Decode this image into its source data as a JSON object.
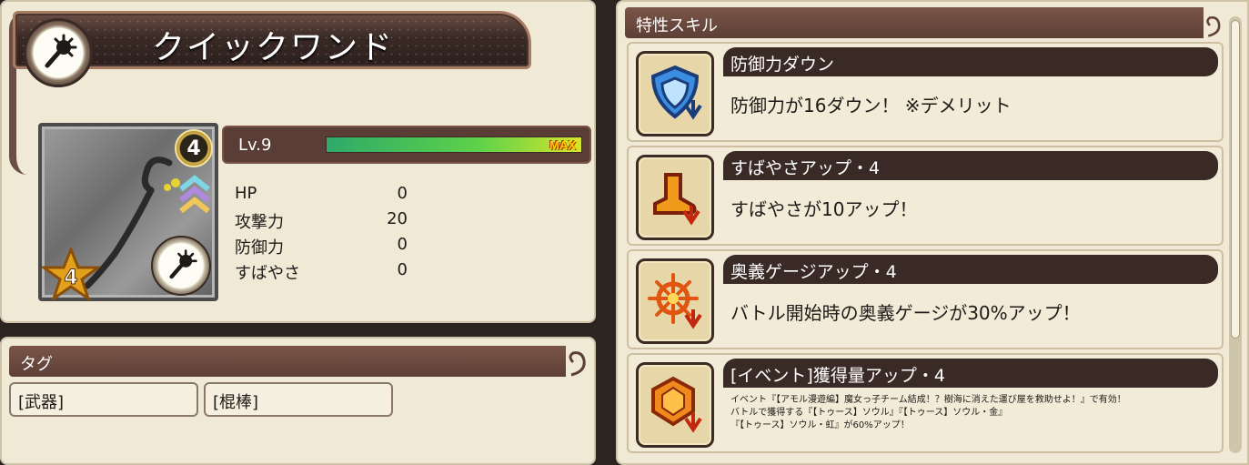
{
  "weapon": {
    "name": "クイックワンド",
    "rank": "4",
    "stars": "4",
    "icon": "mace-icon"
  },
  "level": {
    "label": "Lv.9",
    "max_label": "MAX",
    "progress": 1.0
  },
  "stats": [
    {
      "label": "HP",
      "value": "0"
    },
    {
      "label": "攻撃力",
      "value": "20"
    },
    {
      "label": "防御力",
      "value": "0"
    },
    {
      "label": "すばやさ",
      "value": "0"
    }
  ],
  "tags": {
    "header": "タグ",
    "items": [
      "[武器]",
      "[棍棒]"
    ]
  },
  "skills": {
    "header": "特性スキル",
    "items": [
      {
        "title": "防御力ダウン",
        "desc": "防御力が16ダウン！ ※デメリット",
        "icon": "shield-down-icon"
      },
      {
        "title": "すばやさアップ・4",
        "desc": "すばやさが10アップ！",
        "icon": "boot-up-icon"
      },
      {
        "title": "奥義ゲージアップ・4",
        "desc": "バトル開始時の奥義ゲージが30%アップ！",
        "icon": "burst-up-icon"
      },
      {
        "title": "[イベント]獲得量アップ・4",
        "desc_lines": [
          "イベント『【アモル漫遊編】魔女っ子チーム結成！？樹海に消えた運び屋を救助せよ！』で有効！",
          "バトルで獲得する『【トゥース】ソウル』『【トゥース】ソウル・金』",
          "『【トゥース】ソウル・虹』が60%アップ！"
        ],
        "icon": "gem-up-icon"
      }
    ]
  },
  "colors": {
    "panel_bg": "#efe9d6",
    "header_brown": "#5d3f36",
    "title_dark": "#3a2a25"
  }
}
